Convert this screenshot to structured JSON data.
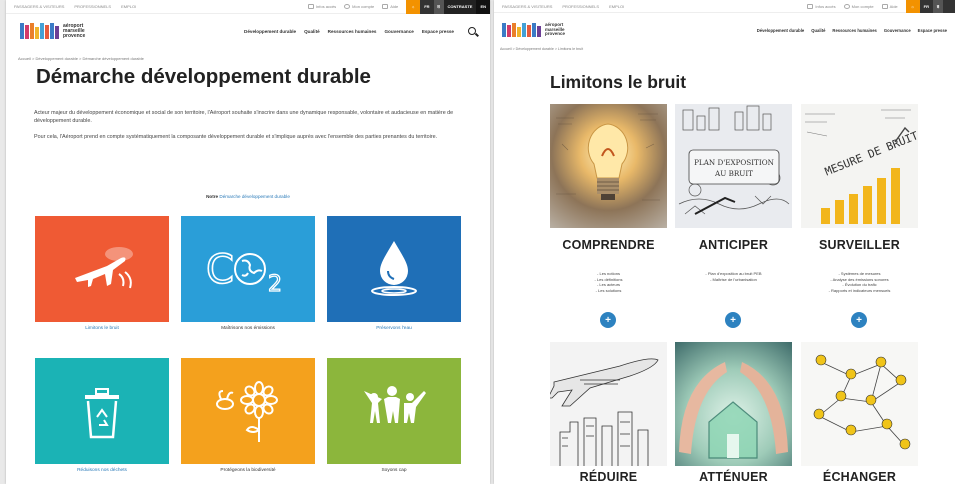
{
  "left": {
    "topbar": {
      "links": [
        "PASSAGERS & VISITEURS",
        "PROFESSIONNELS",
        "EMPLOI"
      ],
      "tools": [
        "Infos accès",
        "Mon compte",
        "Aide"
      ],
      "lang": "FR",
      "contrast": "CONTRASTE",
      "extra": "EN"
    },
    "logo": {
      "line1": "aéroport",
      "line2": "marseille",
      "line3": "provence"
    },
    "nav": [
      "Développement durable",
      "Qualité",
      "Ressources humaines",
      "Gouvernance",
      "Espace presse"
    ],
    "breadcrumb": "Accueil > Développement durable > Démarche développement durable",
    "title": "Démarche développement durable",
    "intro1": "Acteur majeur du développement économique et social de son territoire, l'Aéroport souhaite s'inscrire dans une dynamique responsable, volontaire et audacieuse en matière de développement durable.",
    "intro2": "Pour cela, l'Aéroport prend en compte systématiquement la composante développement durable et s'implique auprès avec l'ensemble des parties prenantes du territoire.",
    "note_prefix": "Notre",
    "note_link": "Démarche développement durable",
    "tiles": [
      {
        "caption": "Limitons le bruit",
        "color": "#ef5a34",
        "icon": "airplane-icon",
        "link": true
      },
      {
        "caption": "Maîtrisons nos émissions",
        "color": "#2a9ed8",
        "icon": "co2-globe-icon",
        "link": false
      },
      {
        "caption": "Préservons l'eau",
        "color": "#1f6fb7",
        "icon": "water-drop-icon",
        "link": true
      },
      {
        "caption": "Réduisons nos déchets",
        "color": "#1bb3b5",
        "icon": "recycle-bin-icon",
        "link": true
      },
      {
        "caption": "Protégeons la biodiversité",
        "color": "#f4a11d",
        "icon": "flower-bee-icon",
        "link": false
      },
      {
        "caption": "Soyons cap",
        "color": "#8cb63c",
        "icon": "people-icon",
        "link": false
      }
    ]
  },
  "right": {
    "topbar": {
      "links": [
        "PASSAGERS & VISITEURS",
        "PROFESSIONNELS",
        "EMPLOI"
      ],
      "tools": [
        "Infos accès",
        "Mon compte",
        "Aide"
      ],
      "lang": "FR"
    },
    "logo": {
      "line1": "aéroport",
      "line2": "marseille",
      "line3": "provence"
    },
    "nav": [
      "Développement durable",
      "Qualité",
      "Ressources humaines",
      "Gouvernance",
      "Espace presse"
    ],
    "breadcrumb": "Accueil > Développement durable > Limitons le bruit",
    "title": "Limitons le bruit",
    "cards": [
      {
        "title": "COMPRENDRE",
        "items": [
          "- Les notions",
          "- Les définitions",
          "- Les acteurs",
          "- Les solutions"
        ],
        "image": "lightbulb-image"
      },
      {
        "title": "ANTICIPER",
        "items": [
          "- Plan d'exposition au bruit PEB",
          "- Maîtrise de l'urbanisation"
        ],
        "image": "plan-exposition-image",
        "image_text": "PLAN D'EXPOSITION AU BRUIT"
      },
      {
        "title": "SURVEILLER",
        "items": [
          "- Systèmes de mesures",
          "- Analyse des émissions sonores",
          "- Évolution du trafic",
          "- Rapports et indicateurs mensuels"
        ],
        "image": "chart-noise-image",
        "image_text": "MESURE DE BRUIT"
      },
      {
        "title": "RÉDUIRE",
        "image": "airplane-sketch-image"
      },
      {
        "title": "ATTÉNUER",
        "image": "house-hands-image"
      },
      {
        "title": "ÉCHANGER",
        "image": "network-people-image"
      }
    ],
    "button_label": "+"
  },
  "colors": {
    "logo_bars": [
      "#3b7bc6",
      "#d23b6a",
      "#ea7f2a",
      "#f0b42b",
      "#44a1d6",
      "#e65b3d",
      "#3b7bc6",
      "#6c3f96"
    ],
    "accent": "#2d82c0"
  }
}
